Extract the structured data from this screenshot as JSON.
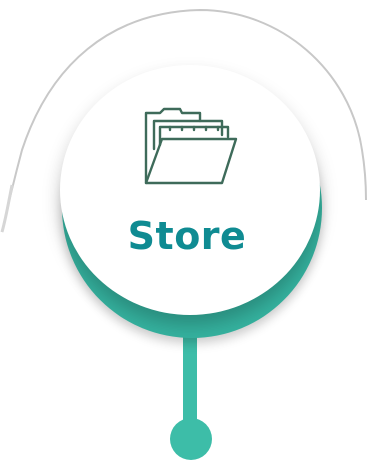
{
  "node": {
    "label": "Store",
    "icon": "folder-icon"
  },
  "colors": {
    "accent_teal": "#3dbda8",
    "label_teal": "#0f8b92",
    "icon_stroke": "#3e6b5a",
    "outline_gray": "#c8c8c8"
  }
}
